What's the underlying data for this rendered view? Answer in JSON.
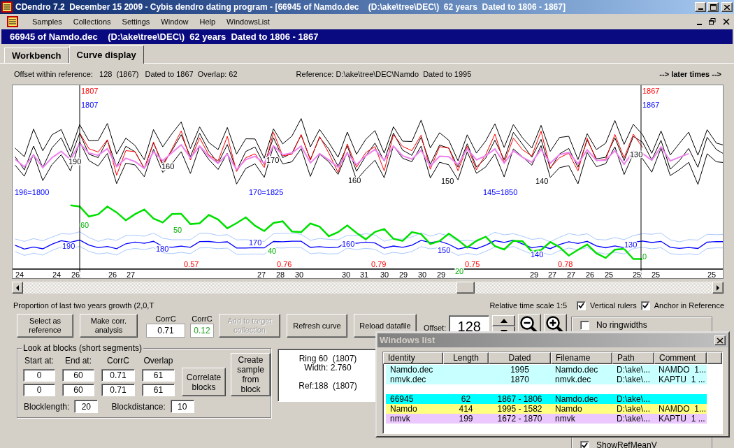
{
  "window": {
    "title": "CDendro 7.2  December 15 2009 - Cybis dendro dating program - [66945 of Namdo.dec    (D:\\ake\\tree\\DEC\\)  62 years  Dated to 1806 - 1867]"
  },
  "menu": [
    "Samples",
    "Collections",
    "Settings",
    "Window",
    "Help",
    "WindowsList"
  ],
  "header": "66945 of Namdo.dec    (D:\\ake\\tree\\DEC\\)  62 years  Dated to 1806 - 1867",
  "tabs": [
    {
      "label": "Workbench",
      "selected": false
    },
    {
      "label": "Curve display",
      "selected": true
    }
  ],
  "info": {
    "offset": "Offset within reference:   128  (1867)   Dated to 1867  Overlap: 62",
    "reference": "Reference: D:\\ake\\tree\\DEC\\Namdo  Dated to 1995",
    "navigation": "--> later times -->"
  },
  "chart": {
    "rulers": [
      {
        "sample_year": "1807",
        "reference_year": "1807"
      },
      {
        "sample_year": "1867",
        "reference_year": "1867"
      }
    ],
    "curve_values": [
      "190",
      "160",
      "170",
      "160",
      "150",
      "140",
      "130"
    ],
    "reference_years": [
      "196=1800",
      "170=1825",
      "145=1850"
    ],
    "mean_values": [
      "190",
      "180",
      "170",
      "160",
      "150",
      "140",
      "130"
    ],
    "growth_values": [
      "60",
      "50",
      "40",
      "20",
      "0"
    ],
    "correlations": [
      "0.57",
      "0.76",
      "0.79",
      "0.75",
      "0.78"
    ],
    "ring_counts": [
      "24",
      "24",
      "26",
      "26",
      "27",
      "27",
      "28",
      "30",
      "30",
      "31",
      "30",
      "29",
      "30",
      "29",
      "29",
      "27",
      "27",
      "26",
      "25",
      "25",
      "25",
      "25"
    ]
  },
  "proportion_text": "Proportion of last two years growth (2,0,T",
  "time_scale": "Relative time scale 1:5",
  "view_checkboxes": [
    {
      "label": "Vertical rulers",
      "checked": true
    },
    {
      "label": "Anchor in Reference",
      "checked": true
    }
  ],
  "actions": [
    {
      "kind": "button",
      "label": "Select as reference",
      "disabled": false
    },
    {
      "kind": "button",
      "label": "Make corr. analysis",
      "disabled": false
    },
    {
      "kind": "corr",
      "label": "CorrC",
      "value": "0.71",
      "highlight": false
    },
    {
      "kind": "corr",
      "label": "CorrC",
      "value": "0.12",
      "highlight": true
    },
    {
      "kind": "button",
      "label": "Add to target collection",
      "disabled": true
    },
    {
      "kind": "button",
      "label": "Refresh curve",
      "disabled": false
    },
    {
      "kind": "button",
      "label": "Reload datafile",
      "disabled": false
    }
  ],
  "offset": {
    "label": "Offset:",
    "value": "128"
  },
  "options": [
    {
      "label": "No ringwidths",
      "checked": false
    },
    {
      "label": "ShowRefMeanV",
      "checked": true
    }
  ],
  "blocks": {
    "title": "Look at blocks (short segments)",
    "columns": [
      "Start at:",
      "End at:",
      "CorrC",
      "Overlap"
    ],
    "rows": [
      [
        "0",
        "60",
        "0.71",
        "61"
      ],
      [
        "0",
        "60",
        "0.71",
        "61"
      ]
    ],
    "correlate_button": "Correlate blocks",
    "create_button": "Create sample from block",
    "blocklength": {
      "label": "Blocklength:",
      "value": "20"
    },
    "blockdistance": {
      "label": "Blockdistance:",
      "value": "10"
    }
  },
  "ring_info": {
    "ring": "Ring 60  (1807)",
    "width": "Width: 2.760",
    "reference": "Ref:188  (1807)"
  },
  "windows_list": {
    "title": "Windows list",
    "columns": [
      "Identity",
      "Length",
      "Dated",
      "Filename",
      "Path",
      "Comment"
    ],
    "groups": [
      {
        "rows": [
          {
            "identity": "Namdo.dec",
            "dated": "1995",
            "filename": "Namdo.dec",
            "path": "D:\\ake\\...",
            "comment": "NAMDO  1...",
            "color": "#c8ffff"
          },
          {
            "identity": "nmvk.dec",
            "dated": "1870",
            "filename": "nmvk.dec",
            "path": "D:\\ake\\...",
            "comment": "KAPTU  1 ...",
            "color": "#c8ffff"
          }
        ]
      },
      {
        "rows": [
          {
            "identity": "66945",
            "length": "62",
            "dated": "1867 - 1806",
            "filename": "Namdo.dec",
            "path": "D:\\ake\\...",
            "color": "#00ffff"
          },
          {
            "identity": "Namdo",
            "length": "414",
            "dated": "1995 - 1582",
            "filename": "Namdo",
            "path": "D:\\ake\\...",
            "comment": "NAMDO  1...",
            "color": "#ffff80"
          },
          {
            "identity": "nmvk",
            "length": "199",
            "dated": "1672 - 1870",
            "filename": "nmvk",
            "path": "D:\\ake\\...",
            "comment": "KAPTU  1 ...",
            "color": "#ebc8ff"
          }
        ]
      }
    ]
  }
}
